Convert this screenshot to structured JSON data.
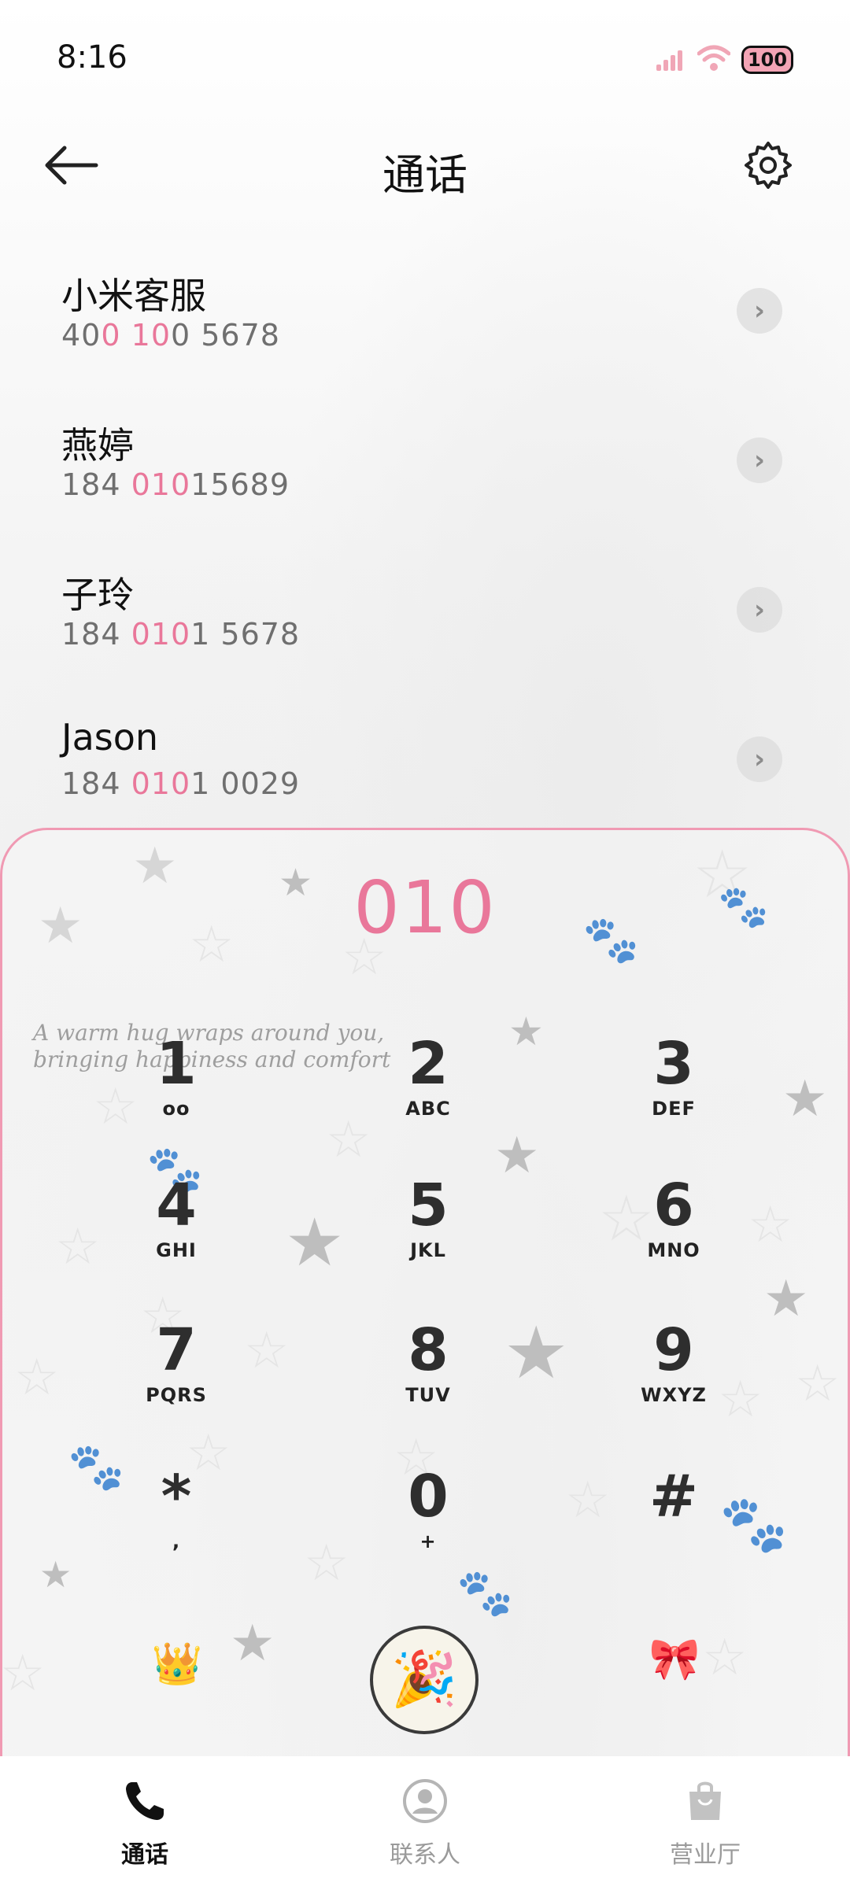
{
  "status_bar": {
    "time": "8:16",
    "battery": "100"
  },
  "header": {
    "title": "通话"
  },
  "contacts": [
    {
      "name": "小米客服",
      "number_parts": [
        {
          "t": "40",
          "h": false
        },
        {
          "t": "0",
          "h": true
        },
        {
          "t": " ",
          "h": false
        },
        {
          "t": "10",
          "h": true
        },
        {
          "t": "0 5678",
          "h": false
        }
      ]
    },
    {
      "name": "燕婷",
      "number_parts": [
        {
          "t": "184 ",
          "h": false
        },
        {
          "t": "010",
          "h": true
        },
        {
          "t": "15689",
          "h": false
        }
      ]
    },
    {
      "name": "子玲",
      "number_parts": [
        {
          "t": "184 ",
          "h": false
        },
        {
          "t": "010",
          "h": true
        },
        {
          "t": "1 5678",
          "h": false
        }
      ]
    },
    {
      "name": "Jason",
      "number_parts": [
        {
          "t": "184 ",
          "h": false
        },
        {
          "t": "010",
          "h": true
        },
        {
          "t": "1 0029",
          "h": false
        }
      ]
    }
  ],
  "dialer": {
    "input": "010",
    "tagline_line1": "A warm hug wraps around you,",
    "tagline_line2": "bringing happiness and comfort",
    "keys": [
      {
        "digit": "1",
        "letters": "ᴏᴏ"
      },
      {
        "digit": "2",
        "letters": "ABC"
      },
      {
        "digit": "3",
        "letters": "DEF"
      },
      {
        "digit": "4",
        "letters": "GHI"
      },
      {
        "digit": "5",
        "letters": "JKL"
      },
      {
        "digit": "6",
        "letters": "MNO"
      },
      {
        "digit": "7",
        "letters": "PQRS"
      },
      {
        "digit": "8",
        "letters": "TUV"
      },
      {
        "digit": "9",
        "letters": "WXYZ"
      },
      {
        "digit": "*",
        "letters": ","
      },
      {
        "digit": "0",
        "letters": "+"
      },
      {
        "digit": "#",
        "letters": ""
      }
    ],
    "left_button_icon": "crown-icon",
    "call_button_icon": "party-popper-icon",
    "right_button_icon": "bow-icon"
  },
  "bottom_nav": [
    {
      "label": "通话",
      "icon": "phone-icon",
      "active": true
    },
    {
      "label": "联系人",
      "icon": "person-icon",
      "active": false
    },
    {
      "label": "营业厅",
      "icon": "bag-icon",
      "active": false
    }
  ],
  "colors": {
    "accent": "#e9779a",
    "panel_border": "#f09ab3",
    "battery_fill": "#f3a4b5"
  }
}
